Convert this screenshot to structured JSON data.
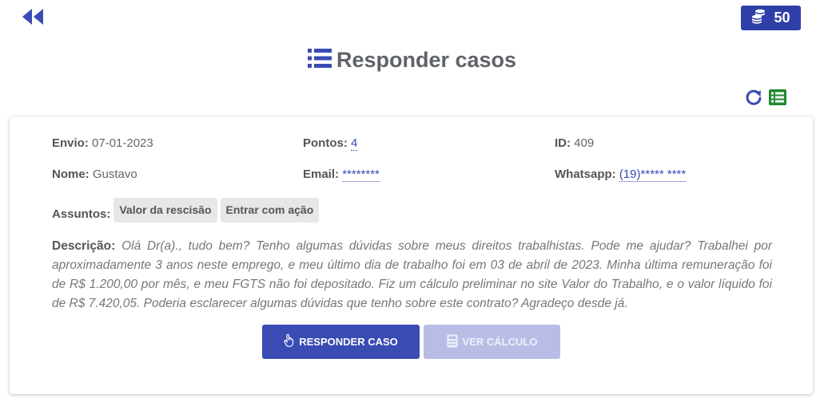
{
  "header": {
    "coins": "50",
    "title": "Responder casos"
  },
  "case": {
    "envio_label": "Envio:",
    "envio_value": "07-01-2023",
    "pontos_label": "Pontos:",
    "pontos_value": "4",
    "id_label": "ID:",
    "id_value": "409",
    "nome_label": "Nome:",
    "nome_value": "Gustavo",
    "email_label": "Email:",
    "email_value": "********",
    "whatsapp_label": "Whatsapp:",
    "whatsapp_value": "(19)***** ****",
    "assuntos_label": "Assuntos:",
    "assuntos": [
      "Valor da rescisão",
      "Entrar com ação"
    ],
    "descricao_label": "Descrição:",
    "descricao_text": "Olá Dr(a)., tudo bem? Tenho algumas dúvidas sobre meus direitos trabalhistas. Pode me ajudar? Trabalhei por aproximadamente 3 anos neste emprego, e meu último dia de trabalho foi em 03 de abril de 2023. Minha última remuneração foi de R$ 1.200,00 por mês, e meu FGTS não foi depositado. Fiz um cálculo preliminar no site Valor do Trabalho, e o valor líquido foi de R$ 7.420,05. Poderia esclarecer algumas dúvidas que tenho sobre este contrato? Agradeço desde já."
  },
  "actions": {
    "responder_label": "RESPONDER CASO",
    "calculo_label": "VER CÁLCULO"
  },
  "colors": {
    "primary": "#3a4bb3",
    "badge": "#2e3fa8",
    "green": "#1e8a2e"
  }
}
